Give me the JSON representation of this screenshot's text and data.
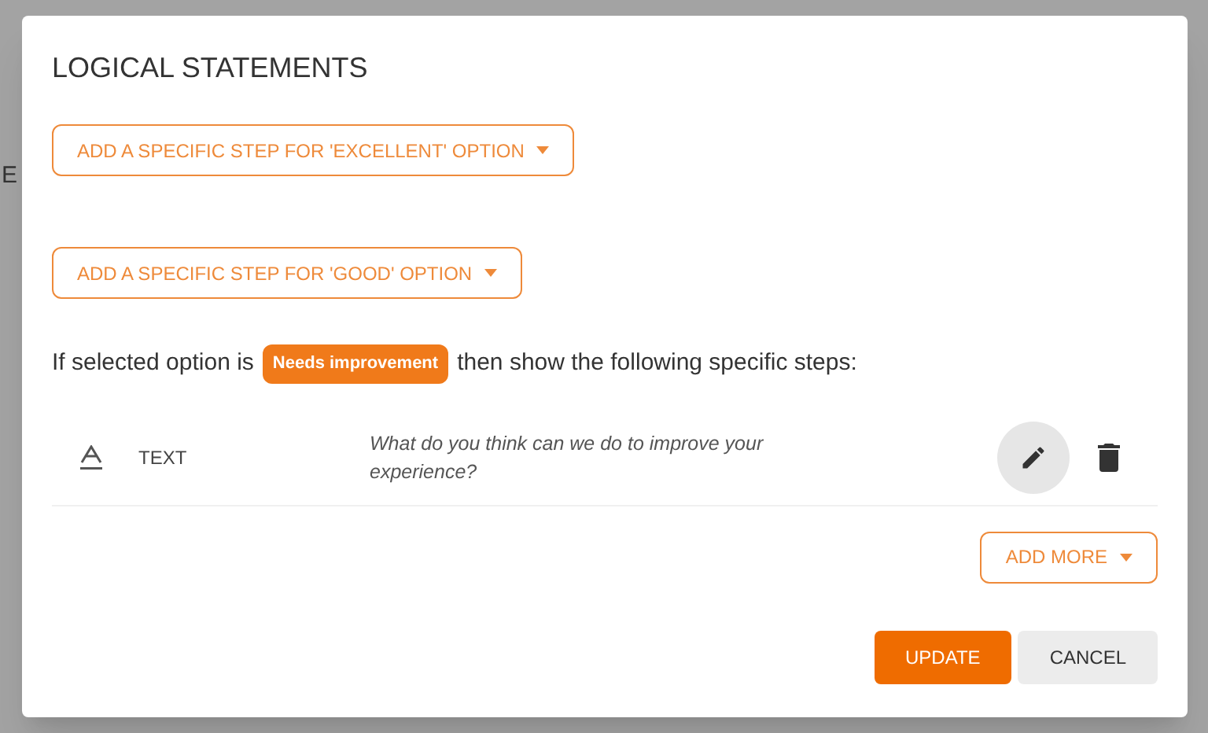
{
  "background": {
    "text": "E"
  },
  "dialog": {
    "title": "LOGICAL STATEMENTS",
    "option_buttons": [
      {
        "label": "ADD A SPECIFIC STEP FOR 'EXCELLENT' OPTION"
      },
      {
        "label": "ADD A SPECIFIC STEP FOR 'GOOD' OPTION"
      }
    ],
    "condition": {
      "before": "If selected option is",
      "badge": "Needs improvement",
      "after": "then show the following specific steps:"
    },
    "steps": [
      {
        "kind": "text",
        "type_label": "TEXT",
        "content": "What do you think can we do to improve your experience?"
      }
    ],
    "add_more": "ADD MORE",
    "buttons": [
      {
        "label": "UPDATE",
        "kind": "primary"
      },
      {
        "label": "CANCEL",
        "kind": "secondary"
      }
    ]
  }
}
